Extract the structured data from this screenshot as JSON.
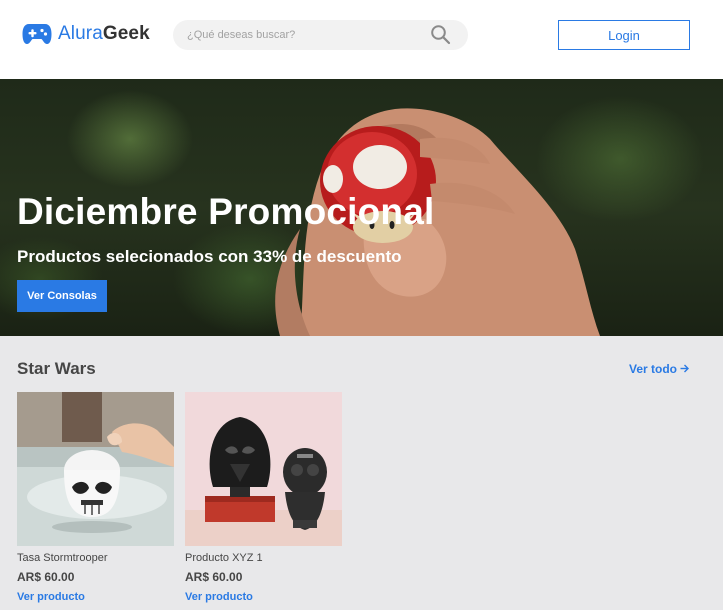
{
  "header": {
    "logo_part1": "Alura",
    "logo_part2": "Geek",
    "search_placeholder": "¿Qué deseas buscar?",
    "login_label": "Login"
  },
  "hero": {
    "title": "Diciembre Promocional",
    "subtitle": "Productos selecionados con 33% de descuento",
    "button_label": "Ver Consolas"
  },
  "section": {
    "title": "Star Wars",
    "see_all_label": "Ver todo"
  },
  "products": [
    {
      "name": "Tasa Stormtrooper",
      "price": "AR$ 60.00",
      "link_label": "Ver producto"
    },
    {
      "name": "Producto XYZ 1",
      "price": "AR$ 60.00",
      "link_label": "Ver producto"
    }
  ],
  "colors": {
    "accent": "#2a7ae4",
    "text": "#464646",
    "page_bg": "#e8e8ea",
    "header_bg": "#ffffff"
  },
  "icons": {
    "logo": "gamepad-icon",
    "search": "search-icon",
    "see_all": "arrow-right-icon"
  }
}
